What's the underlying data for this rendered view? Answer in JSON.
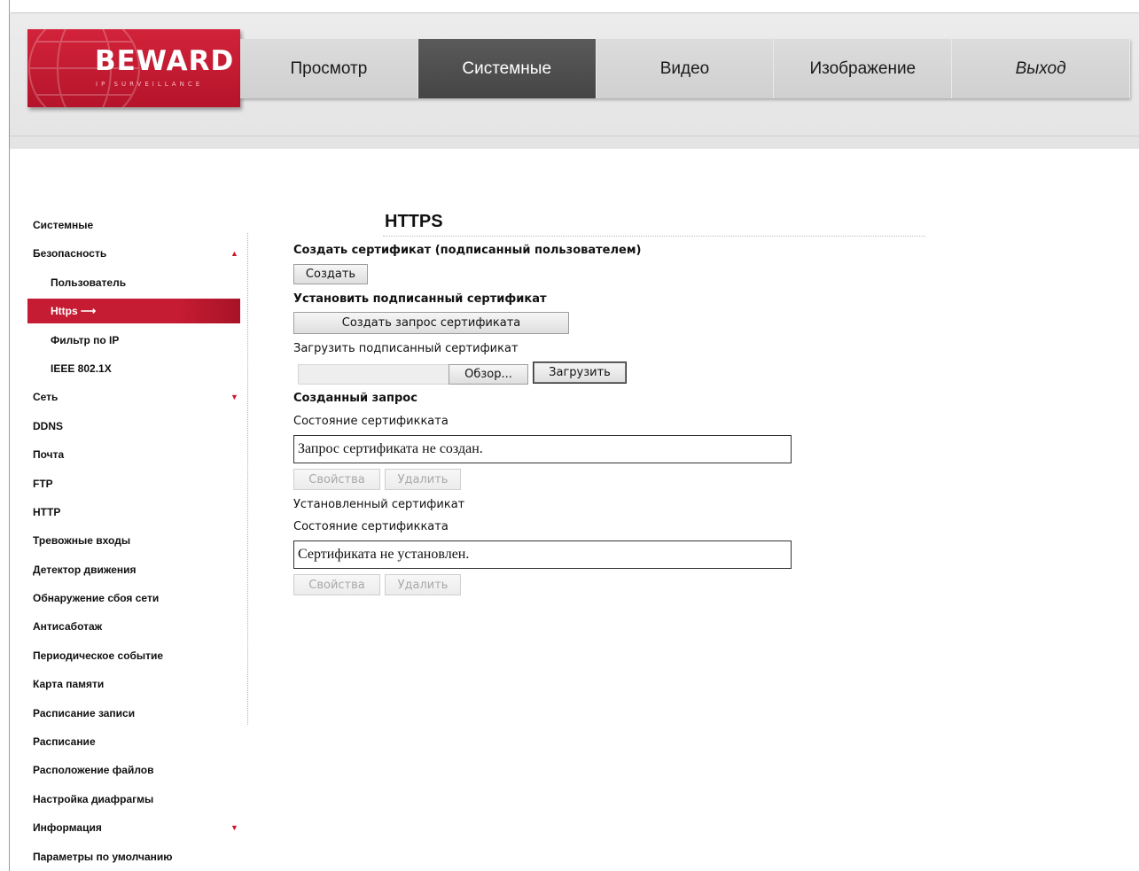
{
  "logo": {
    "brand": "BEWARD",
    "tagline": "IP SURVEILLANCE"
  },
  "nav": {
    "tabs": [
      {
        "label": "Просмотр",
        "active": false
      },
      {
        "label": "Системные",
        "active": true
      },
      {
        "label": "Видео",
        "active": false
      },
      {
        "label": "Изображение",
        "active": false
      },
      {
        "label": "Выход",
        "active": false
      }
    ]
  },
  "sidebar": {
    "items": [
      {
        "label": "Системные"
      },
      {
        "label": "Безопасность",
        "arrow": "▲"
      },
      {
        "label": "Пользователь"
      },
      {
        "label": "Https",
        "arrow_inline": "⟶"
      },
      {
        "label": "Фильтр по IP"
      },
      {
        "label": "IEEE 802.1X"
      },
      {
        "label": "Сеть",
        "arrow": "▼"
      },
      {
        "label": "DDNS"
      },
      {
        "label": "Почта"
      },
      {
        "label": "FTP"
      },
      {
        "label": "HTTP"
      },
      {
        "label": "Тревожные входы"
      },
      {
        "label": "Детектор движения"
      },
      {
        "label": "Обнаружение сбоя сети"
      },
      {
        "label": "Антисаботаж"
      },
      {
        "label": "Периодическое событие"
      },
      {
        "label": "Карта памяти"
      },
      {
        "label": "Расписание записи"
      },
      {
        "label": "Расписание"
      },
      {
        "label": "Расположение файлов"
      },
      {
        "label": "Настройка диафрагмы"
      },
      {
        "label": "Информация",
        "arrow": "▼"
      },
      {
        "label": "Параметры по умолчанию"
      }
    ]
  },
  "main": {
    "title": "HTTPS",
    "create_cert_heading": "Создать сертификат (подписанный пользователем)",
    "create_button": "Создать",
    "install_signed_heading": "Установить подписанный сертификат",
    "create_request_button": "Создать запрос сертификата",
    "upload_signed_label": "Загрузить подписанный сертификат",
    "file_path_value": "",
    "browse_button": "Обзор...",
    "upload_button": "Загрузить",
    "created_request_heading": "Созданный запрос",
    "request_status_label": "Состояние сертификката",
    "request_status_value": "Запрос сертификата не создан.",
    "request_properties_button": "Свойства",
    "request_delete_button": "Удалить",
    "installed_cert_label": "Установленный сертификат",
    "installed_status_label": "Состояние сертификката",
    "installed_status_value": "Сертификата не установлен.",
    "installed_properties_button": "Свойства",
    "installed_delete_button": "Удалить"
  },
  "colors": {
    "brand_red": "#c61c33",
    "active_tab": "#4f4f4f",
    "tab_bg": "#d6d6d6"
  }
}
